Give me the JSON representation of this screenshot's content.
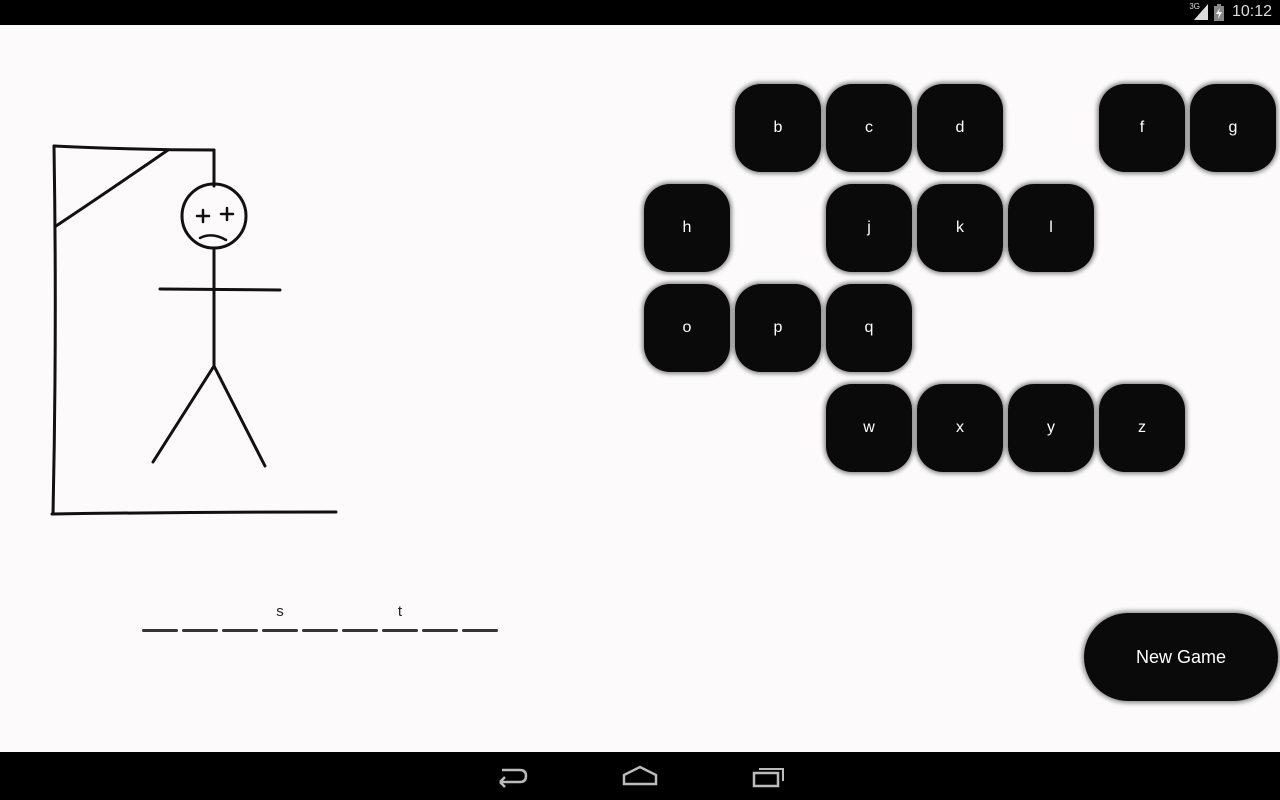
{
  "status_bar": {
    "time": "10:12",
    "network": "3G",
    "icons": [
      "signal-icon",
      "battery-charging-icon"
    ]
  },
  "hangman": {
    "stage": "complete",
    "face": "dead"
  },
  "word": {
    "slots": [
      "",
      "",
      "",
      "s",
      "",
      "",
      "t",
      "",
      ""
    ]
  },
  "keyboard": {
    "rows": [
      [
        {
          "col": 0,
          "letter": ""
        },
        {
          "col": 1,
          "letter": "b"
        },
        {
          "col": 2,
          "letter": "c"
        },
        {
          "col": 3,
          "letter": "d"
        },
        {
          "col": 4,
          "letter": ""
        },
        {
          "col": 5,
          "letter": "f"
        },
        {
          "col": 6,
          "letter": "g"
        }
      ],
      [
        {
          "col": 0,
          "letter": "h"
        },
        {
          "col": 1,
          "letter": ""
        },
        {
          "col": 2,
          "letter": "j"
        },
        {
          "col": 3,
          "letter": "k"
        },
        {
          "col": 4,
          "letter": "l"
        },
        {
          "col": 5,
          "letter": ""
        },
        {
          "col": 6,
          "letter": ""
        }
      ],
      [
        {
          "col": 0,
          "letter": "o"
        },
        {
          "col": 1,
          "letter": "p"
        },
        {
          "col": 2,
          "letter": "q"
        },
        {
          "col": 3,
          "letter": ""
        },
        {
          "col": 4,
          "letter": ""
        },
        {
          "col": 5,
          "letter": ""
        },
        {
          "col": 6,
          "letter": ""
        }
      ],
      [
        {
          "col": 0,
          "letter": ""
        },
        {
          "col": 1,
          "letter": ""
        },
        {
          "col": 2,
          "letter": "w"
        },
        {
          "col": 3,
          "letter": "x"
        },
        {
          "col": 4,
          "letter": "y"
        },
        {
          "col": 5,
          "letter": "z"
        },
        {
          "col": 6,
          "letter": ""
        }
      ]
    ]
  },
  "new_game_label": "New Game",
  "nav_bar": {
    "icons": [
      "back-icon",
      "home-icon",
      "recent-apps-icon"
    ]
  }
}
